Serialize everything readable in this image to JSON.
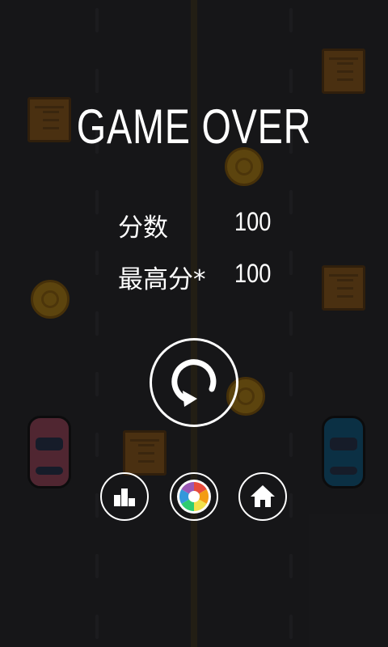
{
  "game": {
    "title": "GAME OVER",
    "score_label": "分数",
    "score_value": "100",
    "best_label": "最高分*",
    "best_value": "100"
  },
  "buttons": {
    "restart": "restart-icon",
    "leaderboard": "leaderboard-icon",
    "share": "camera-aperture-icon",
    "home": "home-icon"
  },
  "colors": {
    "road": "#2b2c2e",
    "overlay": "rgba(10,10,12,0.62)",
    "text": "#ffffff",
    "crate": "#b36e1b",
    "coin": "#e3a313",
    "car_pink": "#c2546f",
    "car_blue": "#0f6fa0"
  }
}
